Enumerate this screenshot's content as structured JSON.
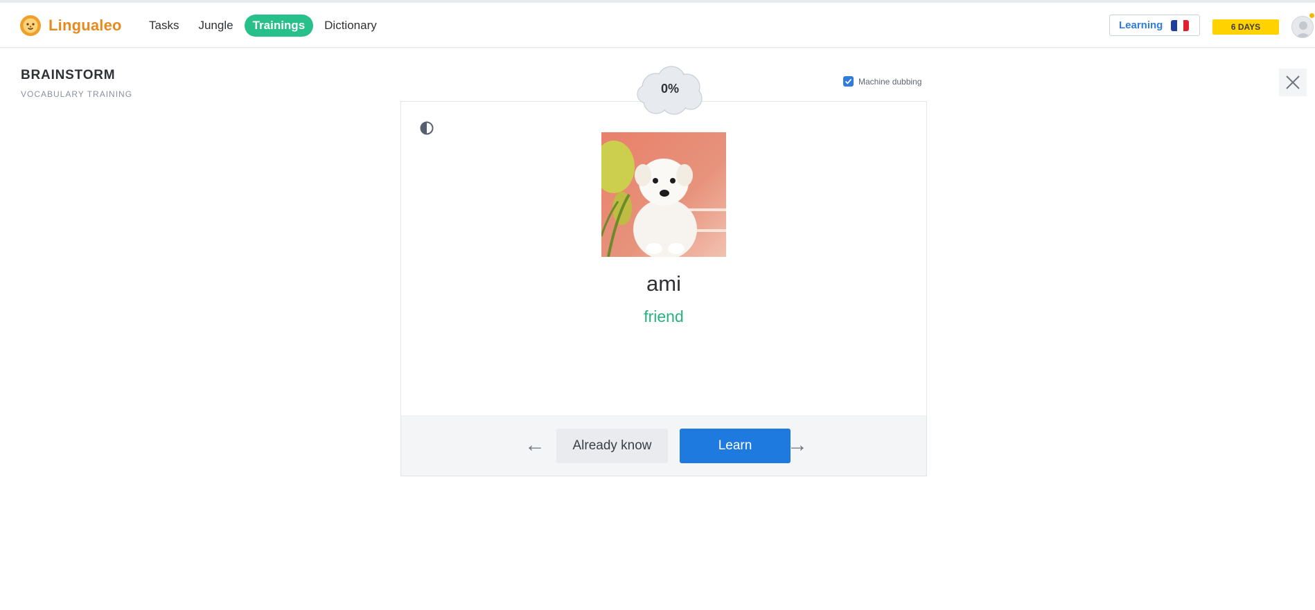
{
  "header": {
    "logo_text": "Lingualeo",
    "nav": [
      {
        "label": "Tasks",
        "active": false
      },
      {
        "label": "Jungle",
        "active": false
      },
      {
        "label": "Trainings",
        "active": true
      },
      {
        "label": "Dictionary",
        "active": false
      }
    ],
    "learning_label": "Learning",
    "learning_flag": "france-flag-icon",
    "streak_label": "6 DAYS",
    "accent_green": "#27c08a",
    "brand_orange": "#e8891d"
  },
  "page": {
    "title": "BRAINSTORM",
    "subtitle": "VOCABULARY TRAINING"
  },
  "progress": {
    "label": "0%",
    "value": 0
  },
  "dubbing": {
    "label": "Machine dubbing",
    "checked": true
  },
  "card": {
    "word": "ami",
    "translation": "friend",
    "image": "white-puppy-image",
    "translation_color": "#27b27d"
  },
  "actions": {
    "already_know": "Already know",
    "learn": "Learn",
    "prev_arrow": "←",
    "next_arrow": "→",
    "learn_color": "#1f7ae0"
  }
}
